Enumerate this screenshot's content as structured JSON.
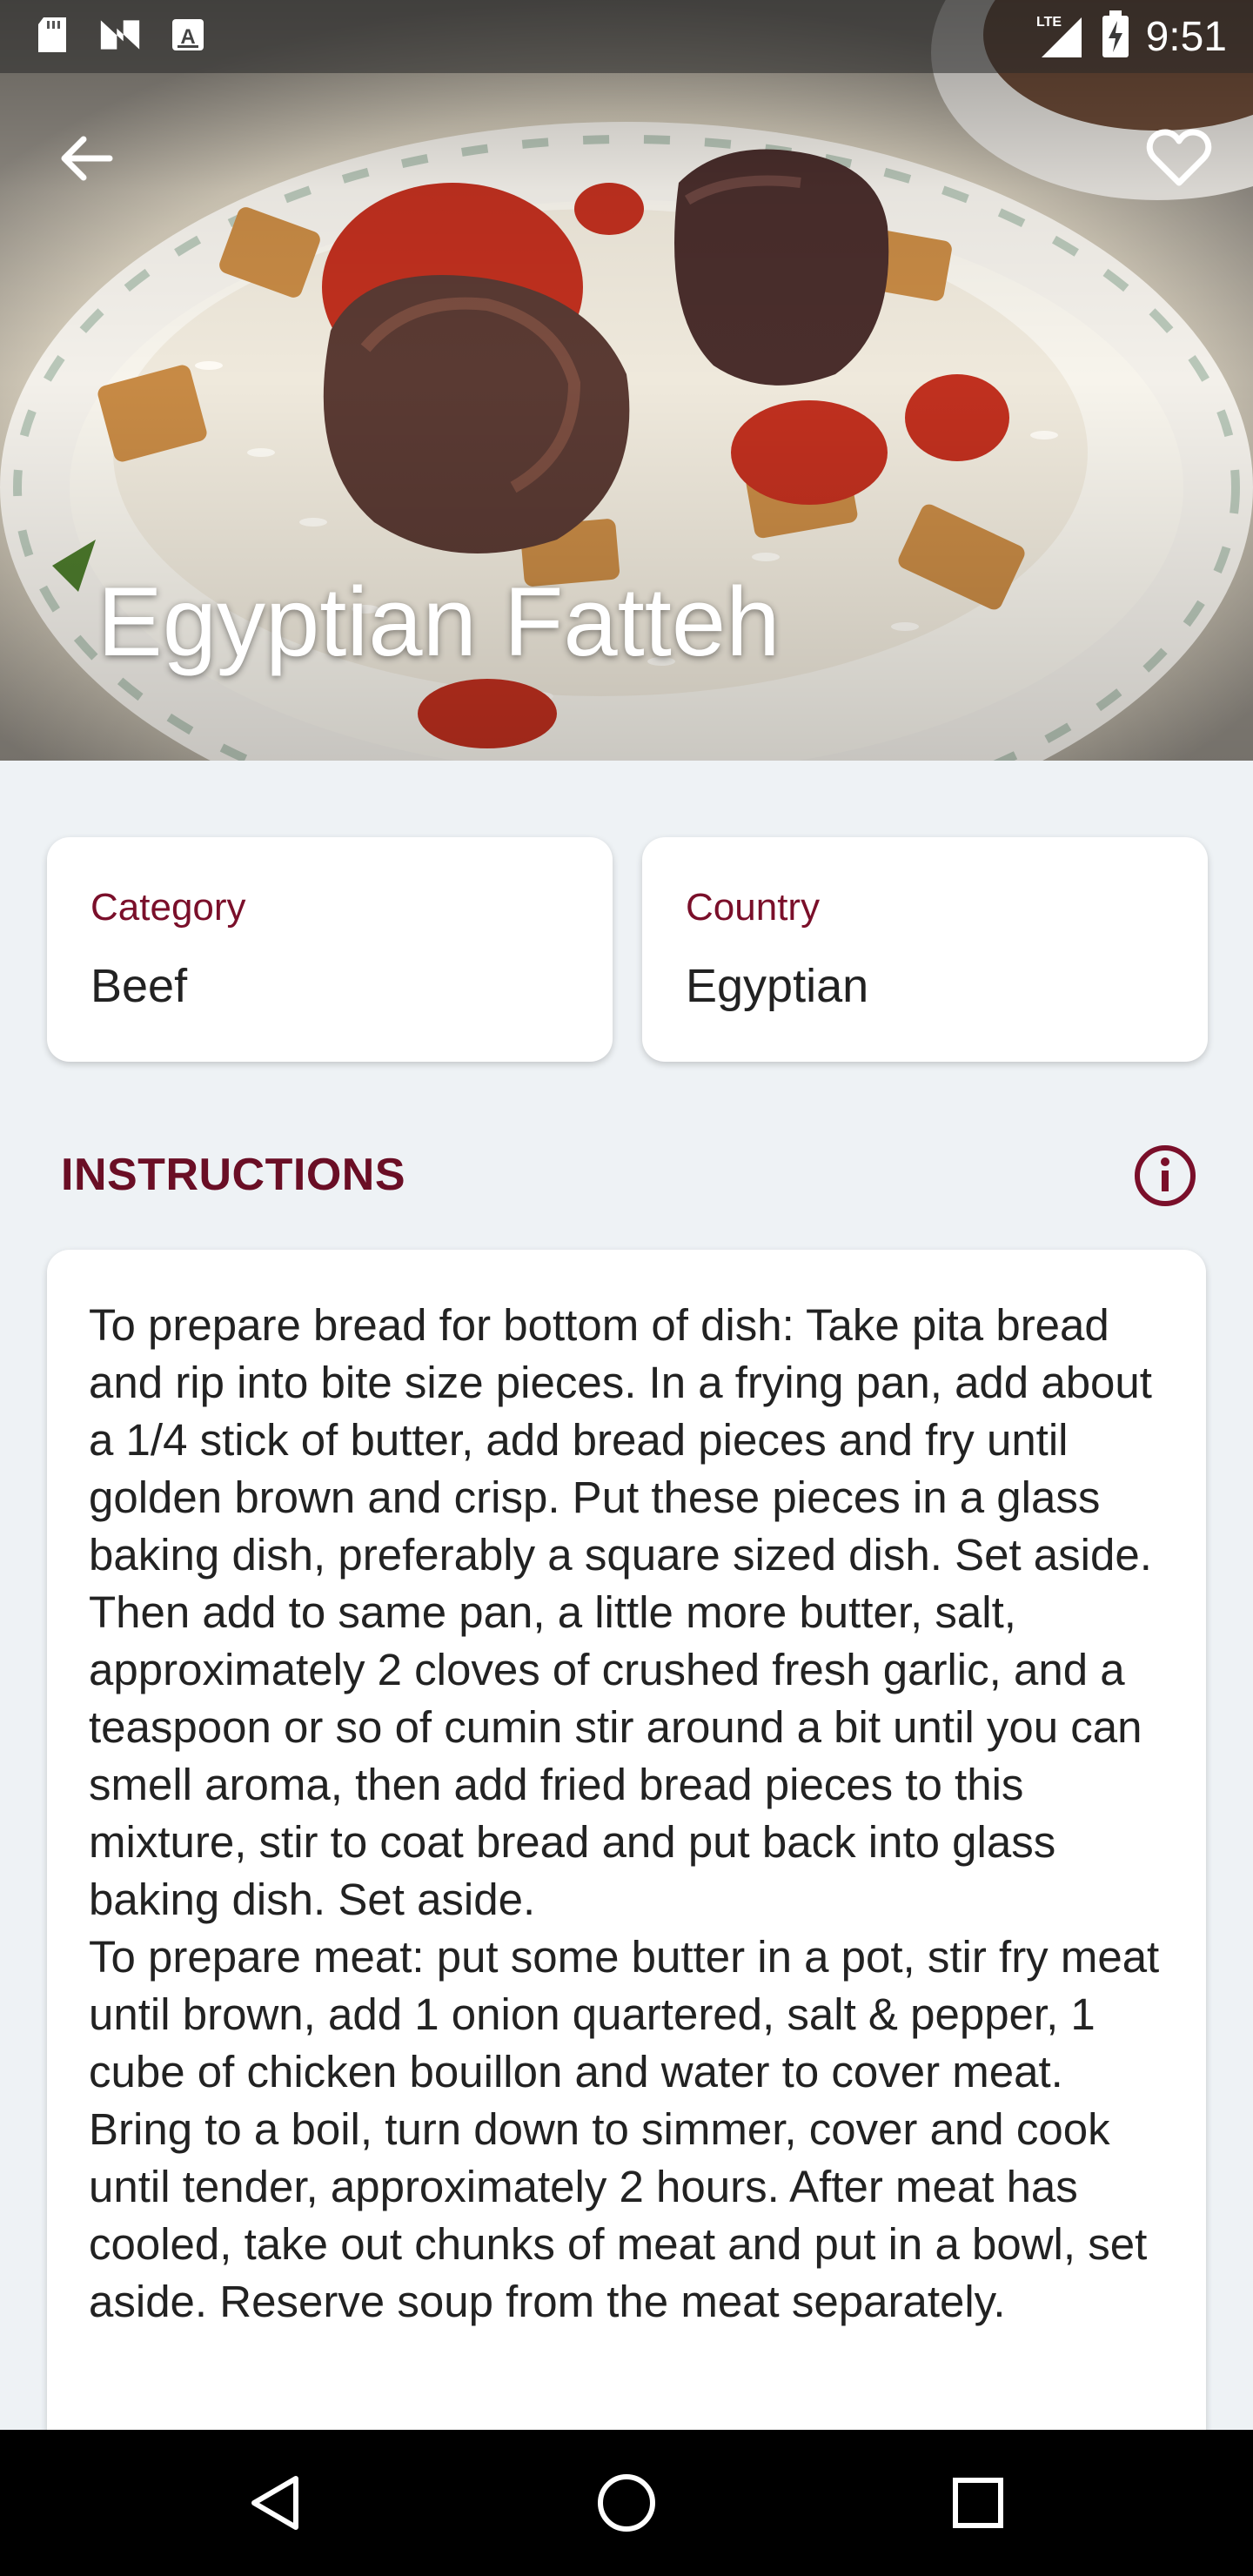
{
  "status_bar": {
    "time": "9:51",
    "network": "LTE",
    "left_icons": [
      "sd-card-icon",
      "n-icon",
      "a-icon"
    ],
    "right_icons": [
      "signal-icon",
      "battery-charging-icon"
    ]
  },
  "header": {
    "back_icon": "arrow-left-icon",
    "favorite_icon": "heart-outline-icon"
  },
  "recipe": {
    "title": "Egyptian Fatteh",
    "category_label": "Category",
    "category_value": "Beef",
    "country_label": "Country",
    "country_value": "Egyptian"
  },
  "instructions": {
    "heading": "INSTRUCTIONS",
    "info_icon": "info-icon",
    "text": "To prepare bread for bottom of dish: Take pita bread and rip into bite size pieces. In a frying pan, add about a 1/4 stick of butter, add bread pieces and fry until golden brown and crisp. Put these pieces in a glass baking dish, preferably a square sized dish. Set aside.\nThen add to same pan, a little more butter, salt, approximately 2 cloves of crushed fresh garlic, and a teaspoon or so of cumin stir around a bit until you can smell aroma, then add fried bread pieces to this mixture, stir to coat bread and put back into glass baking dish. Set aside.\nTo prepare meat: put some butter in a pot, stir fry meat until brown, add 1 onion quartered, salt & pepper, 1 cube of chicken bouillon and water to cover meat. Bring to a boil, turn down to simmer, cover and cook until tender, approximately 2 hours. After meat has cooled, take out chunks of meat and put in a bowl, set aside. Reserve soup from the meat separately."
  },
  "nav_bar": {
    "icons": [
      "back-triangle-icon",
      "home-circle-icon",
      "recents-square-icon"
    ]
  },
  "colors": {
    "accent": "#7a0f2a",
    "background": "#eef2f5",
    "card": "#ffffff"
  }
}
